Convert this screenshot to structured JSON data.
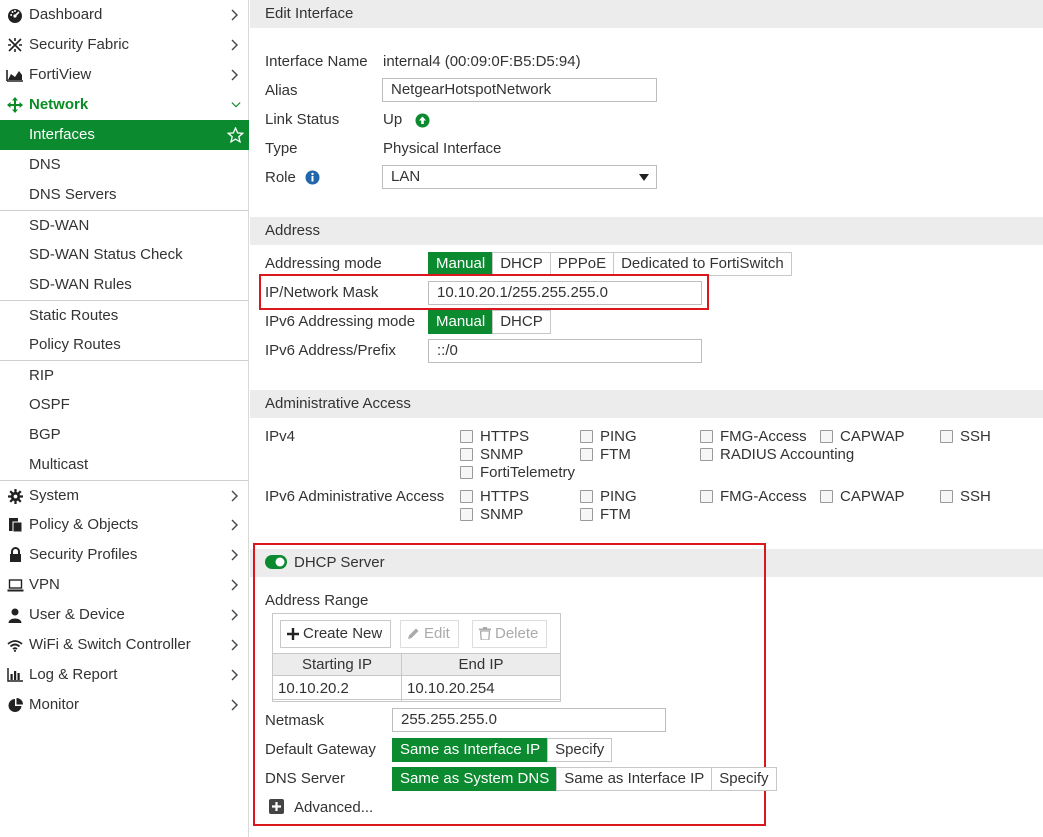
{
  "sidebar": {
    "items": [
      {
        "label": "Dashboard",
        "icon": "dashboard-icon"
      },
      {
        "label": "Security Fabric",
        "icon": "security-fabric-icon"
      },
      {
        "label": "FortiView",
        "icon": "fortiview-icon"
      },
      {
        "label": "Network",
        "icon": "network-icon"
      },
      {
        "label": "Interfaces"
      },
      {
        "label": "DNS"
      },
      {
        "label": "DNS Servers"
      },
      {
        "label": "SD-WAN"
      },
      {
        "label": "SD-WAN Status Check"
      },
      {
        "label": "SD-WAN Rules"
      },
      {
        "label": "Static Routes"
      },
      {
        "label": "Policy Routes"
      },
      {
        "label": "RIP"
      },
      {
        "label": "OSPF"
      },
      {
        "label": "BGP"
      },
      {
        "label": "Multicast"
      },
      {
        "label": "System",
        "icon": "gear-icon"
      },
      {
        "label": "Policy & Objects",
        "icon": "policy-icon"
      },
      {
        "label": "Security Profiles",
        "icon": "lock-icon"
      },
      {
        "label": "VPN",
        "icon": "laptop-icon"
      },
      {
        "label": "User & Device",
        "icon": "user-icon"
      },
      {
        "label": "WiFi & Switch Controller",
        "icon": "wifi-icon"
      },
      {
        "label": "Log & Report",
        "icon": "bar-chart-icon"
      },
      {
        "label": "Monitor",
        "icon": "pie-chart-icon"
      }
    ]
  },
  "edit_interface": {
    "title": "Edit Interface",
    "interface_name_label": "Interface Name",
    "interface_name_value": "internal4 (00:09:0F:B5:D5:94)",
    "alias_label": "Alias",
    "alias_value": "NetgearHotspotNetwork",
    "link_status_label": "Link Status",
    "link_status_value": "Up",
    "type_label": "Type",
    "type_value": "Physical Interface",
    "role_label": "Role",
    "role_value": "LAN"
  },
  "address": {
    "title": "Address",
    "addressing_mode_label": "Addressing mode",
    "addressing_modes": [
      "Manual",
      "DHCP",
      "PPPoE",
      "Dedicated to FortiSwitch"
    ],
    "ip_mask_label": "IP/Network Mask",
    "ip_mask_value": "10.10.20.1/255.255.255.0",
    "ipv6_mode_label": "IPv6 Addressing mode",
    "ipv6_modes": [
      "Manual",
      "DHCP"
    ],
    "ipv6_prefix_label": "IPv6 Address/Prefix",
    "ipv6_prefix_value": "::/0"
  },
  "admin_access": {
    "title": "Administrative Access",
    "ipv4_label": "IPv4",
    "ipv4_options": [
      "HTTPS",
      "PING",
      "FMG-Access",
      "CAPWAP",
      "SSH",
      "SNMP",
      "FTM",
      "RADIUS Accounting",
      "FortiTelemetry"
    ],
    "ipv6_label": "IPv6 Administrative Access",
    "ipv6_options": [
      "HTTPS",
      "PING",
      "FMG-Access",
      "CAPWAP",
      "SSH",
      "SNMP",
      "FTM"
    ]
  },
  "dhcp": {
    "title": "DHCP Server",
    "address_range_label": "Address Range",
    "create_label": "Create New",
    "edit_label": "Edit",
    "delete_label": "Delete",
    "table_headers": [
      "Starting IP",
      "End IP"
    ],
    "table_rows": [
      [
        "10.10.20.2",
        "10.10.20.254"
      ]
    ],
    "netmask_label": "Netmask",
    "netmask_value": "255.255.255.0",
    "gateway_label": "Default Gateway",
    "gateway_options": [
      "Same as Interface IP",
      "Specify"
    ],
    "dns_label": "DNS Server",
    "dns_options": [
      "Same as System DNS",
      "Same as Interface IP",
      "Specify"
    ],
    "advanced_label": "Advanced..."
  },
  "colors": {
    "accent_green": "#0b8a2f",
    "highlight_red": "#d9171c"
  }
}
